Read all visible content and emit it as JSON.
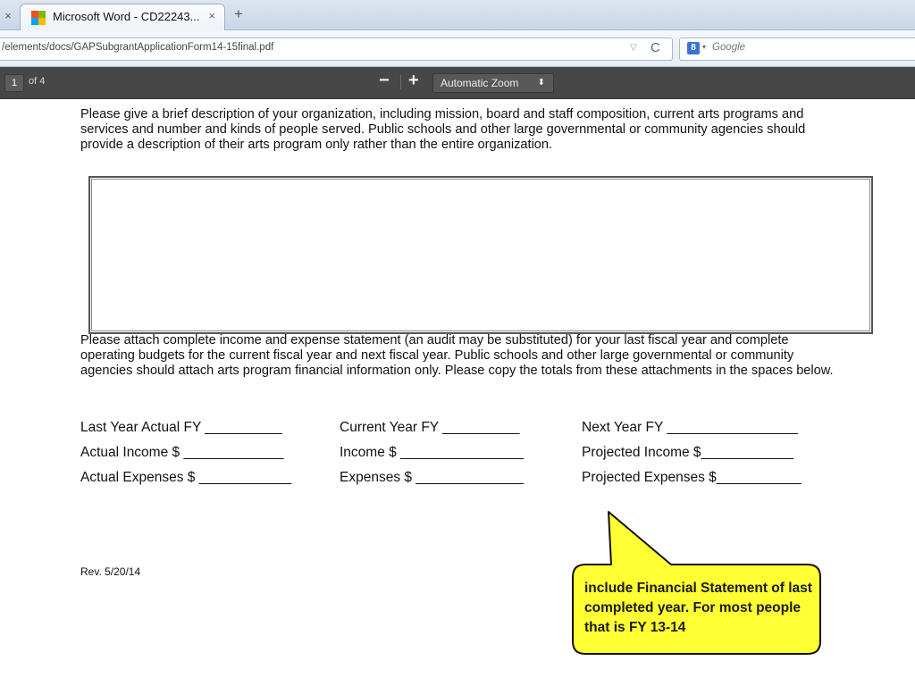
{
  "browser": {
    "tab_title": "Microsoft Word - CD22243...",
    "tab_close": "×",
    "prev_tab_close": "×",
    "new_tab": "+",
    "url": "/elements/docs/GAPSubgrantApplicationForm14-15final.pdf",
    "url_dropdown": "▽",
    "reload": "C",
    "search_engine_badge": "8",
    "search_caret": "▾",
    "search_placeholder": "Google"
  },
  "pdf_toolbar": {
    "page_number": "1",
    "page_count": "of 4",
    "zoom_out": "−",
    "zoom_in": "+",
    "zoom_value": "Automatic Zoom",
    "zoom_caret": "⬍"
  },
  "document": {
    "para1": "Please give a brief description of your organization, including mission, board and staff composition, current arts programs and services and number and kinds of people served.  Public schools and other large governmental or community agencies should provide a description of their arts program only rather than the entire organization.",
    "para2": "Please attach complete income and expense statement (an audit may be substituted) for your last fiscal year and complete operating budgets for the current fiscal year and next fiscal year.  Public schools and other large governmental or community agencies should attach arts program financial information only.  Please copy the totals from these attachments in the spaces below.",
    "financials": {
      "last_year": "Last Year Actual FY __________",
      "current_year": "Current Year FY __________",
      "next_year": "Next Year FY _________________",
      "actual_income": "Actual Income $ _____________",
      "income": "Income $ ________________",
      "projected_income": "Projected Income $____________",
      "actual_expenses": "Actual Expenses $ ____________",
      "expenses": "Expenses $ ______________",
      "projected_expenses": "Projected Expenses $___________"
    },
    "revision": "Rev. 5/20/14"
  },
  "callout": {
    "text": "include Financial Statement of last completed year.  For most people that is FY 13-14",
    "fill": "#ffff33",
    "stroke": "#111111"
  }
}
